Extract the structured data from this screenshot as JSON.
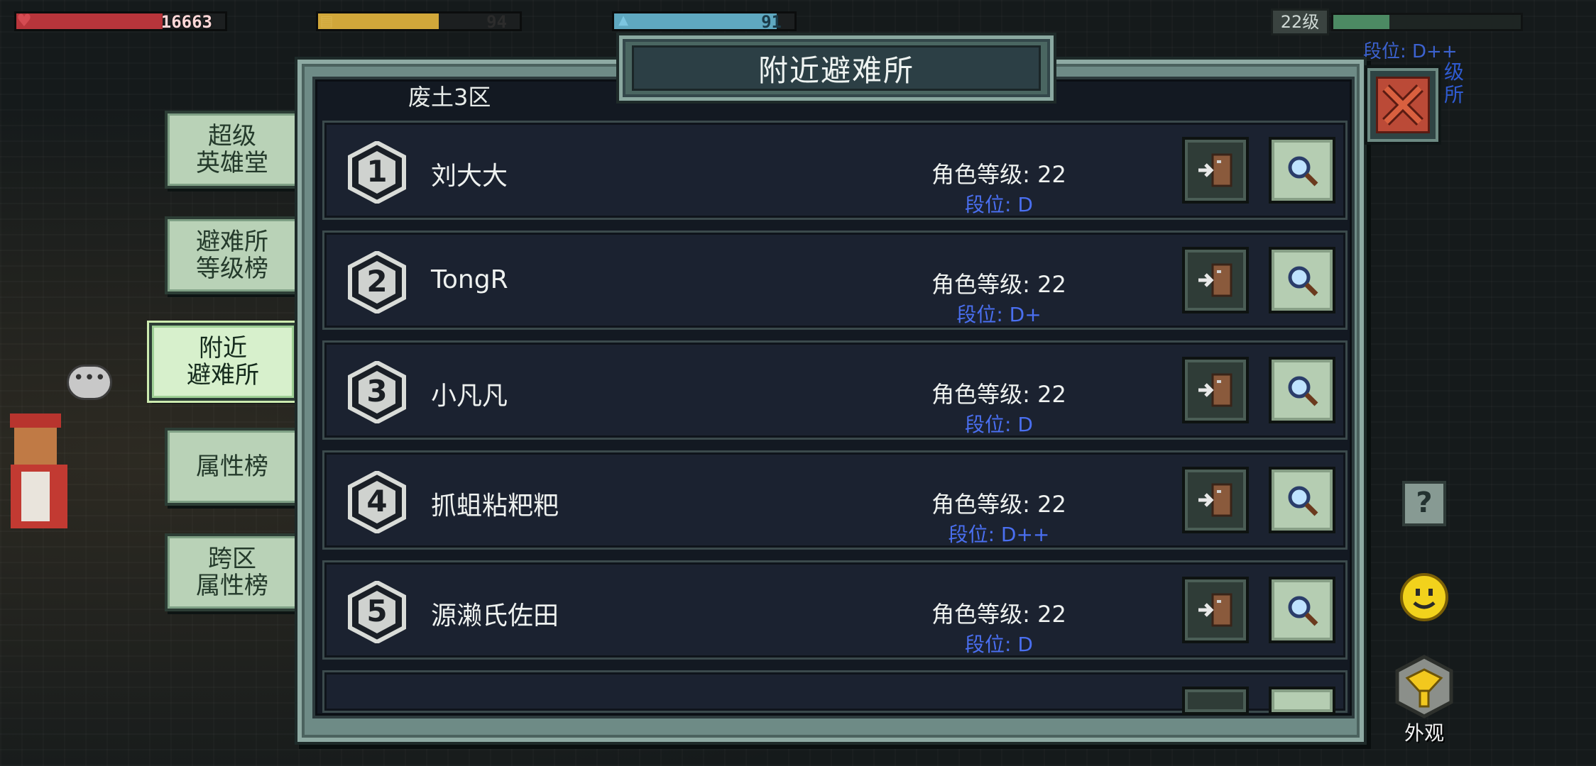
{
  "hud": {
    "health_value": "16663",
    "health_fill": 0.7,
    "food_value": "94",
    "food_fill": 0.6,
    "water_value": "91",
    "water_fill": 0.9,
    "level": "22级",
    "xp_fill": 0.3,
    "rank_text": "段位: D++",
    "side_text": "级所"
  },
  "left_tabs": [
    {
      "label": "超级\n英雄堂",
      "active": false
    },
    {
      "label": "避难所\n等级榜",
      "active": false
    },
    {
      "label": "附近\n避难所",
      "active": true
    },
    {
      "label": "属性榜",
      "active": false
    },
    {
      "label": "跨区\n属性榜",
      "active": false
    }
  ],
  "panel": {
    "title": "附近避难所",
    "zone": "废土3区"
  },
  "rows": [
    {
      "rank": "1",
      "name": "刘大大",
      "level_text": "角色等级: 22",
      "tier_text": "段位: D"
    },
    {
      "rank": "2",
      "name": "TongR",
      "level_text": "角色等级: 22",
      "tier_text": "段位: D+"
    },
    {
      "rank": "3",
      "name": "小凡凡",
      "level_text": "角色等级: 22",
      "tier_text": "段位: D"
    },
    {
      "rank": "4",
      "name": "抓蛆粘粑粑",
      "level_text": "角色等级: 22",
      "tier_text": "段位: D++"
    },
    {
      "rank": "5",
      "name": "源濑氏佐田",
      "level_text": "角色等级: 22",
      "tier_text": "段位: D"
    }
  ],
  "right_buttons": {
    "help": "?",
    "appearance": "外观"
  },
  "chat_bubble": "•••",
  "colors": {
    "tier_blue": "#4a6ff0",
    "close_red": "#bb4a37",
    "tab_active": "#d7f0cc",
    "panel_frame": "#6e8b86"
  },
  "icons": [
    "heart-icon",
    "food-icon",
    "water-icon",
    "door-enter-icon",
    "magnifier-icon",
    "close-x-icon",
    "help-icon",
    "smiley-icon",
    "appearance-icon"
  ]
}
